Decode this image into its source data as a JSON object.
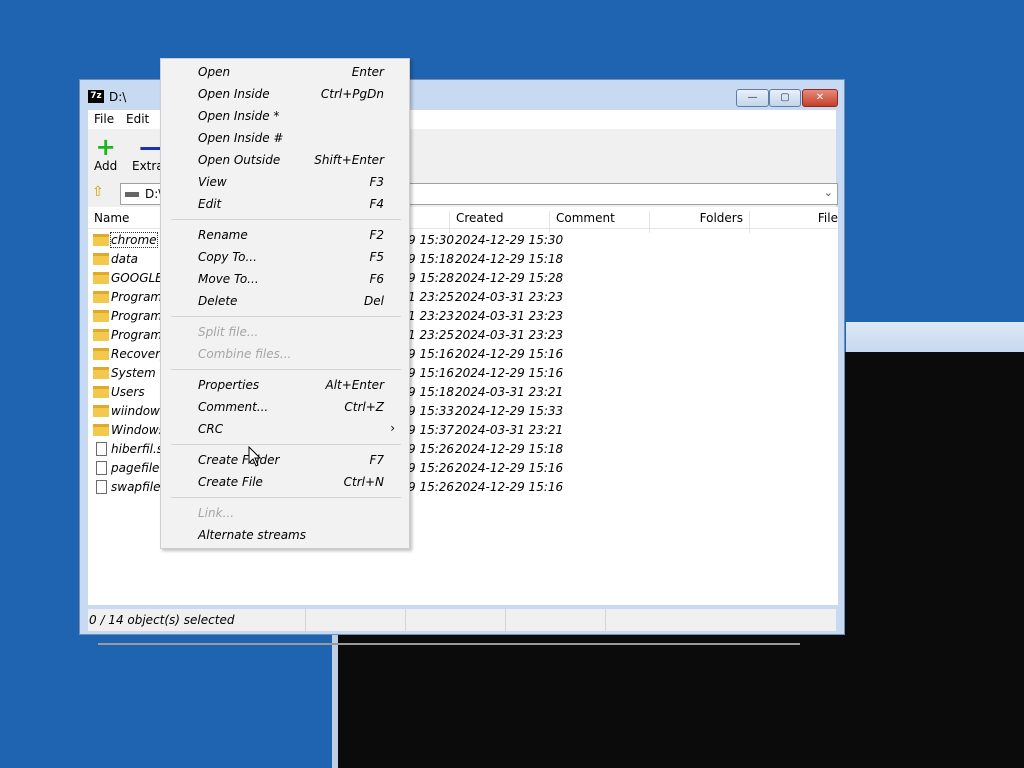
{
  "window": {
    "title": "D:\\",
    "app_icon": "7z",
    "controls": {
      "min": "—",
      "max": "▢",
      "close": "✕"
    }
  },
  "menubar": {
    "items": [
      "File",
      "Edit"
    ]
  },
  "toolbar": {
    "add_label": "Add",
    "extract_label": "Extrac",
    "add_icon": "+",
    "extract_icon": "—"
  },
  "address": {
    "path": "D:\\",
    "up_icon": "folder-up-icon",
    "chevron": "⌄"
  },
  "columns": {
    "name": "Name",
    "created": "Created",
    "comment": "Comment",
    "folders": "Folders",
    "files": "File"
  },
  "files": [
    {
      "name": "chrome",
      "type": "folder",
      "modified_fragment": "9 15:30",
      "created": "2024-12-29 15:30"
    },
    {
      "name": "data",
      "type": "folder",
      "modified_fragment": "9 15:18",
      "created": "2024-12-29 15:18"
    },
    {
      "name": "GOOGLE",
      "type": "folder",
      "modified_fragment": "9 15:28",
      "created": "2024-12-29 15:28"
    },
    {
      "name": "Program",
      "type": "folder",
      "modified_fragment": "1 23:25",
      "created": "2024-03-31 23:23"
    },
    {
      "name": "Program",
      "type": "folder",
      "modified_fragment": "1 23:23",
      "created": "2024-03-31 23:23"
    },
    {
      "name": "ProgramD",
      "type": "folder",
      "modified_fragment": "1 23:25",
      "created": "2024-03-31 23:23"
    },
    {
      "name": "Recovery",
      "type": "folder",
      "modified_fragment": "9 15:16",
      "created": "2024-12-29 15:16"
    },
    {
      "name": "System Vo",
      "type": "folder",
      "modified_fragment": "9 15:16",
      "created": "2024-12-29 15:16"
    },
    {
      "name": "Users",
      "type": "folder",
      "modified_fragment": "9 15:18",
      "created": "2024-03-31 23:21"
    },
    {
      "name": "wiindows",
      "type": "folder",
      "modified_fragment": "9 15:33",
      "created": "2024-12-29 15:33"
    },
    {
      "name": "Windows",
      "type": "folder",
      "modified_fragment": "9 15:37",
      "created": "2024-03-31 23:21"
    },
    {
      "name": "hiberfil.sy",
      "type": "file",
      "modified_fragment": "9 15:26",
      "created": "2024-12-29 15:18"
    },
    {
      "name": "pagefile.s",
      "type": "file",
      "modified_fragment": "9 15:26",
      "created": "2024-12-29 15:16"
    },
    {
      "name": "swapfile.s",
      "type": "file",
      "modified_fragment": "9 15:26",
      "created": "2024-12-29 15:16"
    }
  ],
  "status": {
    "text": "0 / 14 object(s) selected"
  },
  "context_menu": {
    "groups": [
      [
        {
          "label": "Open",
          "shortcut": "Enter",
          "enabled": true
        },
        {
          "label": "Open Inside",
          "shortcut": "Ctrl+PgDn",
          "enabled": true
        },
        {
          "label": "Open Inside *",
          "shortcut": "",
          "enabled": true
        },
        {
          "label": "Open Inside #",
          "shortcut": "",
          "enabled": true
        },
        {
          "label": "Open Outside",
          "shortcut": "Shift+Enter",
          "enabled": true
        },
        {
          "label": "View",
          "shortcut": "F3",
          "enabled": true
        },
        {
          "label": "Edit",
          "shortcut": "F4",
          "enabled": true
        }
      ],
      [
        {
          "label": "Rename",
          "shortcut": "F2",
          "enabled": true
        },
        {
          "label": "Copy To...",
          "shortcut": "F5",
          "enabled": true
        },
        {
          "label": "Move To...",
          "shortcut": "F6",
          "enabled": true
        },
        {
          "label": "Delete",
          "shortcut": "Del",
          "enabled": true
        }
      ],
      [
        {
          "label": "Split file...",
          "shortcut": "",
          "enabled": false
        },
        {
          "label": "Combine files...",
          "shortcut": "",
          "enabled": false
        }
      ],
      [
        {
          "label": "Properties",
          "shortcut": "Alt+Enter",
          "enabled": true
        },
        {
          "label": "Comment...",
          "shortcut": "Ctrl+Z",
          "enabled": true
        },
        {
          "label": "CRC",
          "shortcut": "",
          "enabled": true,
          "submenu": true
        }
      ],
      [
        {
          "label": "Create Folder",
          "shortcut": "F7",
          "enabled": true
        },
        {
          "label": "Create File",
          "shortcut": "Ctrl+N",
          "enabled": true
        }
      ],
      [
        {
          "label": "Link...",
          "shortcut": "",
          "enabled": false
        },
        {
          "label": "Alternate streams",
          "shortcut": "",
          "enabled": true
        }
      ]
    ],
    "submenu_arrow": "›"
  },
  "colors": {
    "desktop": "#1f64b0",
    "folder": "#f2c94c",
    "add": "#1db51d",
    "extract": "#1b2fbf",
    "disabled_text": "#a5a5a5"
  }
}
